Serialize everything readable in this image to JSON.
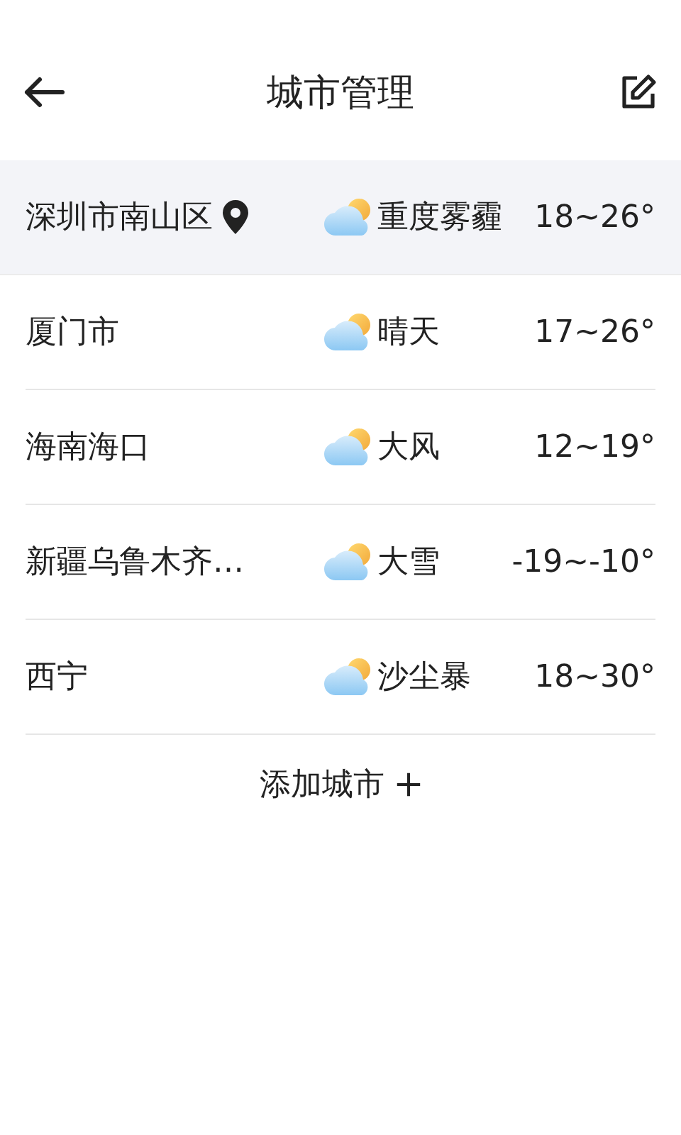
{
  "header": {
    "title": "城市管理"
  },
  "cities": [
    {
      "name": "深圳市南山区",
      "current": true,
      "condition": "重度雾霾",
      "temp": "18~26°"
    },
    {
      "name": "厦门市",
      "current": false,
      "condition": "晴天",
      "temp": "17~26°"
    },
    {
      "name": "海南海口",
      "current": false,
      "condition": "大风",
      "temp": "12~19°"
    },
    {
      "name": "新疆乌鲁木齐…",
      "current": false,
      "condition": "大雪",
      "temp": "-19~-10°"
    },
    {
      "name": "西宁",
      "current": false,
      "condition": "沙尘暴",
      "temp": "18~30°"
    }
  ],
  "add_city": {
    "label": "添加城市"
  }
}
